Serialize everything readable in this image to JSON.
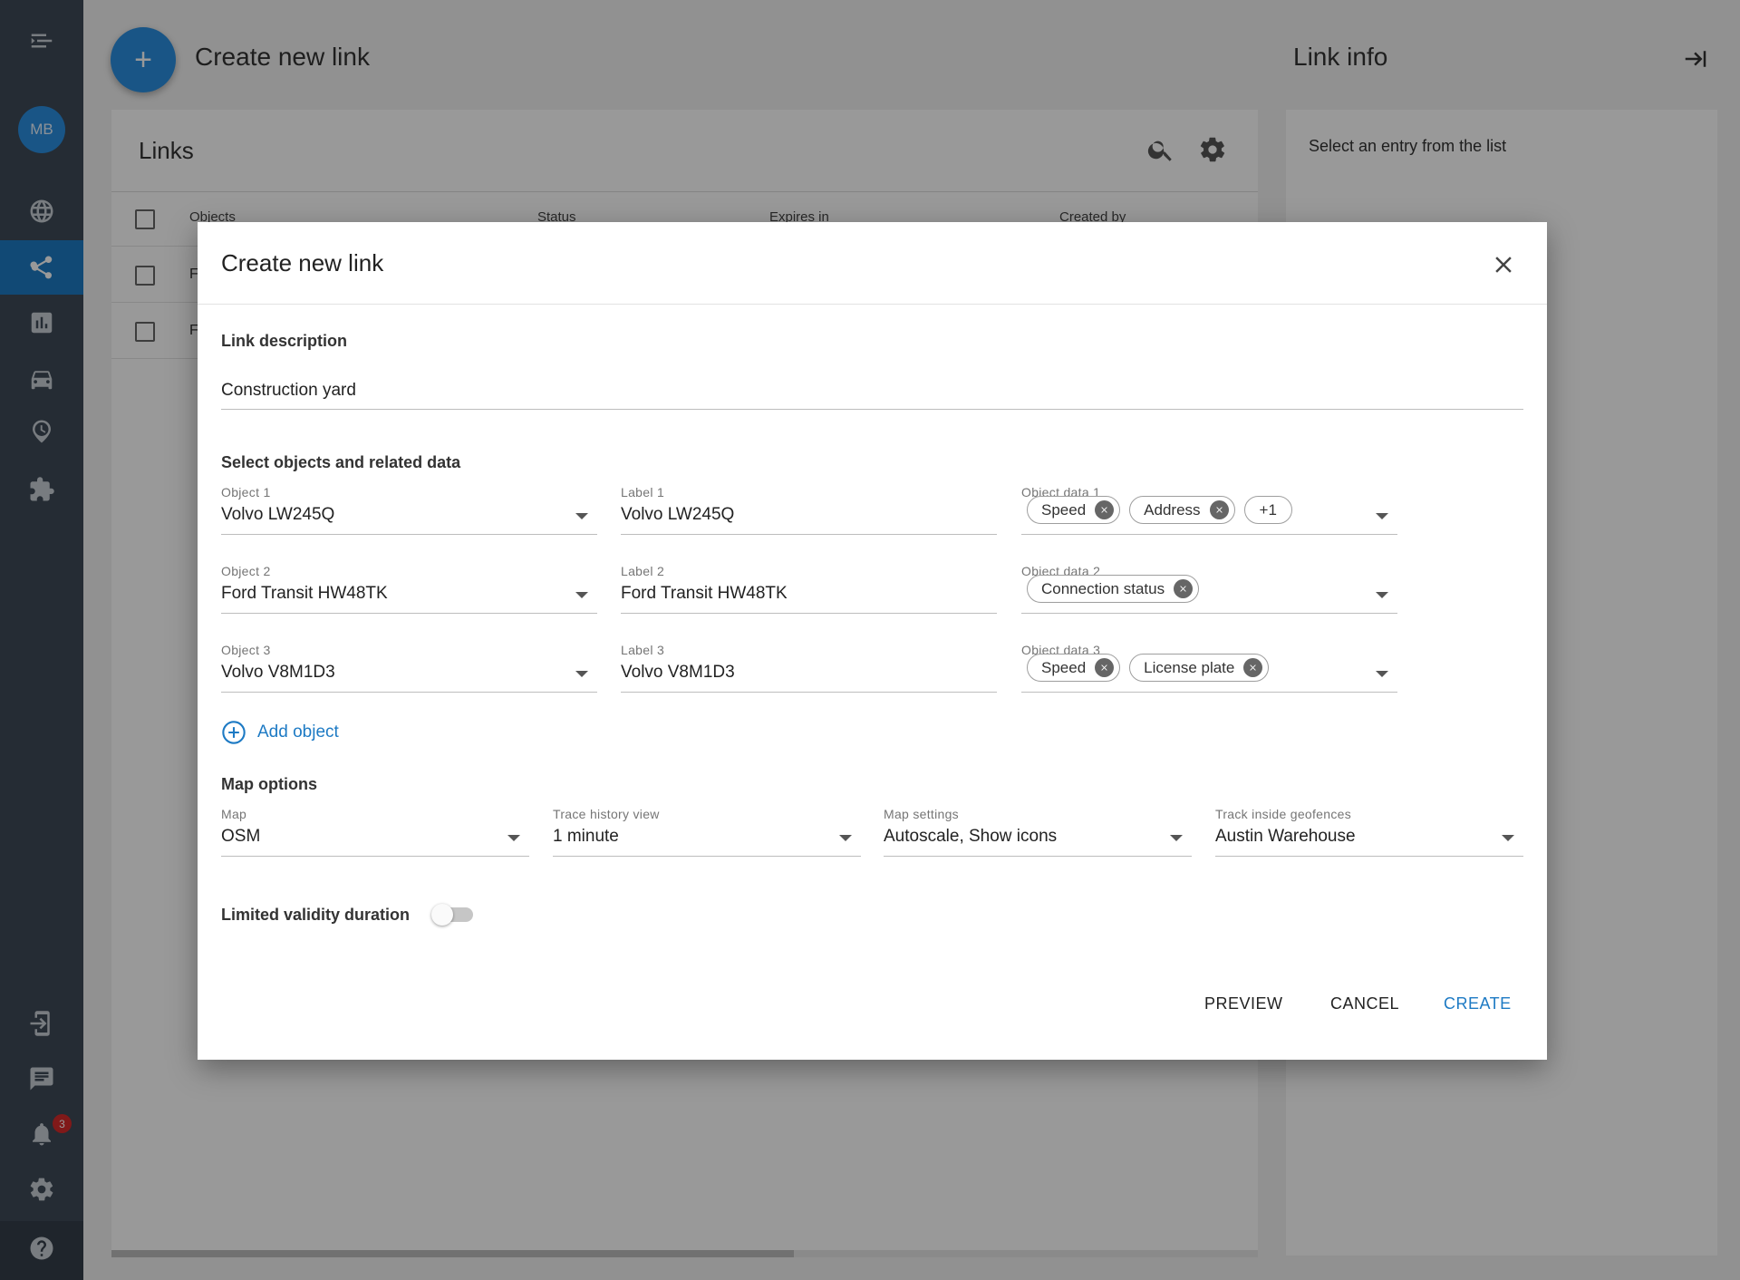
{
  "sidebar": {
    "avatar_initials": "MB",
    "notification_count": "3",
    "active_item": "links",
    "items_top": [
      "globe-icon",
      "share-icon",
      "chart-icon",
      "car-icon",
      "clock-pin-icon",
      "puzzle-icon"
    ],
    "items_bottom": [
      "login-icon",
      "chat-icon",
      "bell-icon",
      "gear-icon",
      "help-icon"
    ]
  },
  "page": {
    "title": "Create new link",
    "fab_label": "+"
  },
  "links_panel": {
    "title": "Links",
    "columns": [
      "Objects",
      "Status",
      "Expires in",
      "Created by"
    ],
    "rows": [
      "F",
      "F"
    ]
  },
  "info_panel": {
    "title": "Link info",
    "placeholder": "Select an entry from the list"
  },
  "dialog": {
    "title": "Create new link",
    "description_section": "Link description",
    "description_value": "Construction yard",
    "objects_section": "Select objects and related data",
    "objects": [
      {
        "object_label": "Object 1",
        "object_value": "Volvo LW245Q",
        "label_label": "Label 1",
        "label_value": "Volvo LW245Q",
        "data_label": "Object data 1",
        "chips": [
          "Speed",
          "Address"
        ],
        "more": "+1"
      },
      {
        "object_label": "Object 2",
        "object_value": "Ford Transit HW48TK",
        "label_label": "Label 2",
        "label_value": "Ford Transit HW48TK",
        "data_label": "Object data 2",
        "chips": [
          "Connection status"
        ],
        "more": ""
      },
      {
        "object_label": "Object 3",
        "object_value": "Volvo V8M1D3",
        "label_label": "Label 3",
        "label_value": "Volvo V8M1D3",
        "data_label": "Object data 3",
        "chips": [
          "Speed",
          "License plate"
        ],
        "more": ""
      }
    ],
    "add_object": "Add object",
    "map_section": "Map options",
    "map_fields": [
      {
        "label": "Map",
        "value": "OSM"
      },
      {
        "label": "Trace history view",
        "value": "1 minute"
      },
      {
        "label": "Map settings",
        "value": "Autoscale, Show icons"
      },
      {
        "label": "Track inside geofences",
        "value": "Austin Warehouse"
      }
    ],
    "limited_validity_label": "Limited validity duration",
    "limited_validity_on": false,
    "buttons": {
      "preview": "PREVIEW",
      "cancel": "CANCEL",
      "create": "CREATE"
    }
  },
  "colors": {
    "accent": "#1d7ac4",
    "sidebar": "#3e4a57",
    "badge": "#d62a2a"
  }
}
